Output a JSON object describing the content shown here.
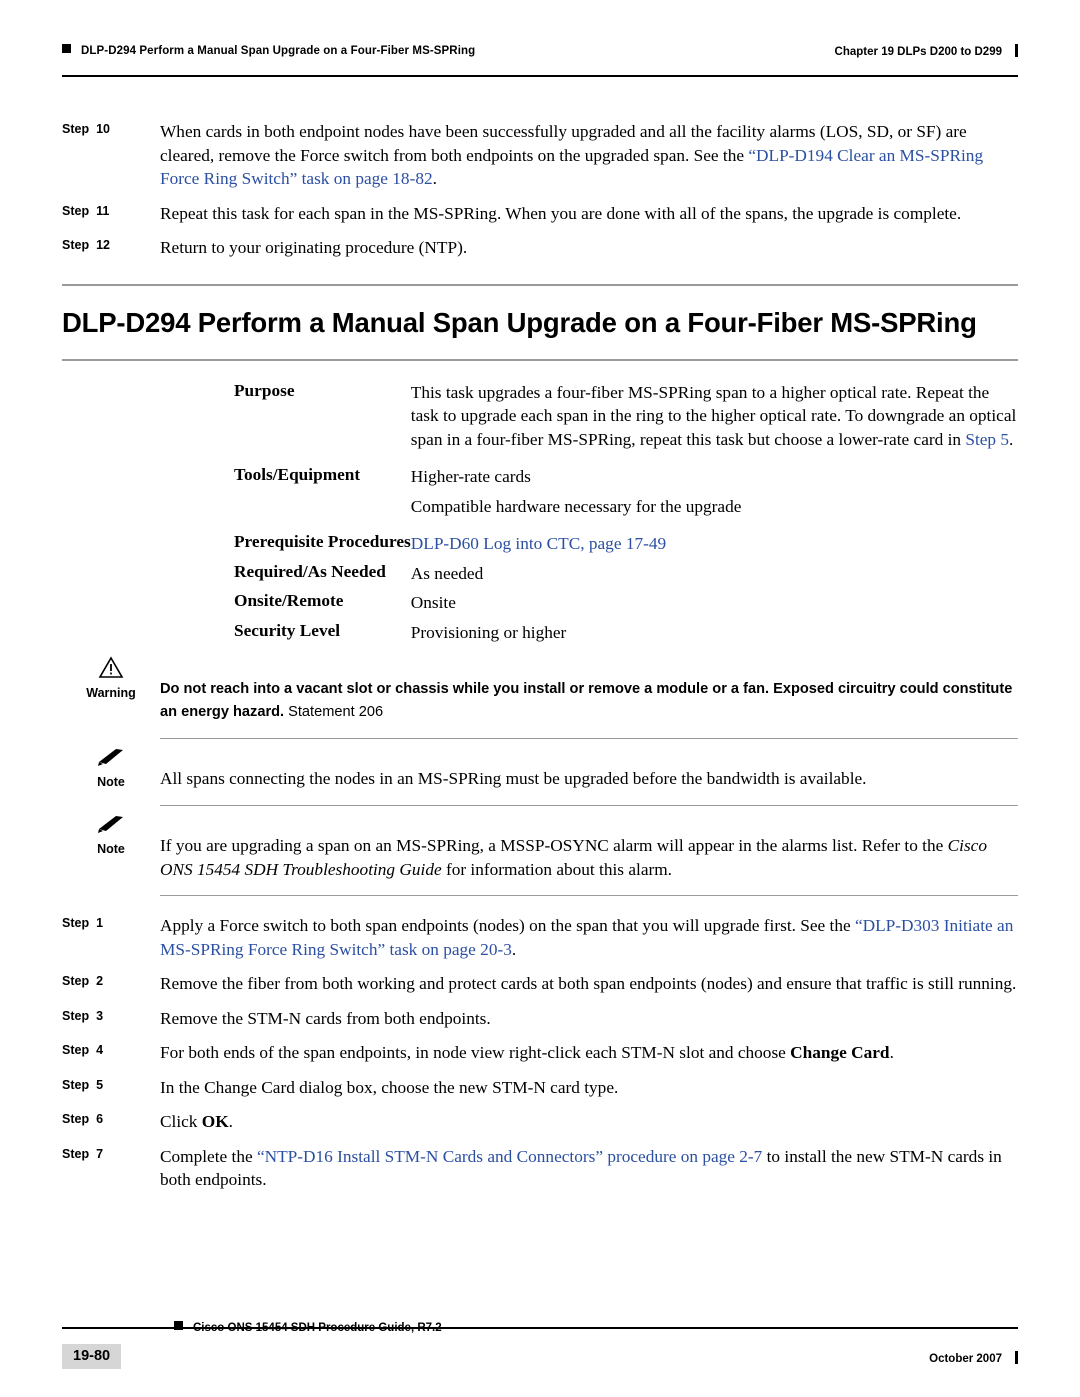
{
  "header": {
    "left": "DLP-D294 Perform a Manual Span Upgrade on a Four-Fiber MS-SPRing",
    "right": "Chapter 19 DLPs D200 to D299"
  },
  "top_steps": [
    {
      "label": "Step",
      "num": "10",
      "text_before": "When cards in both endpoint nodes have been successfully upgraded and all the facility alarms (LOS, SD, or SF) are cleared, remove the Force switch from both endpoints on the upgraded span. See the ",
      "link": "“DLP-D194 Clear an MS-SPRing Force Ring Switch” task on page 18-82",
      "text_after": "."
    },
    {
      "label": "Step",
      "num": "11",
      "text_before": "Repeat this task for each span in the MS-SPRing. When you are done with all of the spans, the upgrade is complete.",
      "link": "",
      "text_after": ""
    },
    {
      "label": "Step",
      "num": "12",
      "text_before": "Return to your originating procedure (NTP).",
      "link": "",
      "text_after": ""
    }
  ],
  "section": {
    "title": "DLP-D294 Perform a Manual Span Upgrade on a Four-Fiber MS-SPRing"
  },
  "definitions": [
    {
      "key": "Purpose",
      "value_pre": "This task upgrades a four-fiber MS-SPRing span to a higher optical rate. Repeat the task to upgrade each span in the ring to the higher optical rate. To downgrade an optical span in a four-fiber MS-SPRing, repeat this task but choose a lower-rate card in ",
      "value_link": "Step 5",
      "value_post": ".",
      "value2": ""
    },
    {
      "key": "Tools/Equipment",
      "value_pre": "Higher-rate cards",
      "value_link": "",
      "value_post": "",
      "value2": "Compatible hardware necessary for the upgrade"
    },
    {
      "key": "Prerequisite Procedures",
      "value_pre": "",
      "value_link": "DLP-D60 Log into CTC, page 17-49",
      "value_post": "",
      "value2": ""
    },
    {
      "key": "Required/As Needed",
      "value_pre": "As needed",
      "value_link": "",
      "value_post": "",
      "value2": ""
    },
    {
      "key": "Onsite/Remote",
      "value_pre": "Onsite",
      "value_link": "",
      "value_post": "",
      "value2": ""
    },
    {
      "key": "Security Level",
      "value_pre": "Provisioning or higher",
      "value_link": "",
      "value_post": "",
      "value2": ""
    }
  ],
  "warning": {
    "label": "Warning",
    "icon": "warning-triangle-icon",
    "bold_text": "Do not reach into a vacant slot or chassis while you install or remove a module or a fan. Exposed circuitry could constitute an energy hazard.",
    "statement": " Statement 206"
  },
  "note1": {
    "label": "Note",
    "icon": "note-pencil-icon",
    "text": "All spans connecting the nodes in an MS-SPRing must be upgraded before the bandwidth is available."
  },
  "note2": {
    "label": "Note",
    "icon": "note-pencil-icon",
    "text_pre": "If you are upgrading a span on an MS-SPRing, a MSSP-OSYNC alarm will appear in the alarms list. Refer to the ",
    "italic": "Cisco ONS 15454 SDH Troubleshooting Guide",
    "text_post": " for information about this alarm."
  },
  "bottom_steps": [
    {
      "label": "Step",
      "num": "1",
      "pre": "Apply a Force switch to both span endpoints (nodes) on the span that you will upgrade first. See the ",
      "link": "“DLP-D303 Initiate an MS-SPRing Force Ring Switch” task on page 20-3",
      "post": ".",
      "bold": ""
    },
    {
      "label": "Step",
      "num": "2",
      "pre": "Remove the fiber from both working and protect cards at both span endpoints (nodes) and ensure that traffic is still running.",
      "link": "",
      "post": "",
      "bold": ""
    },
    {
      "label": "Step",
      "num": "3",
      "pre": "Remove the STM-N cards from both endpoints.",
      "link": "",
      "post": "",
      "bold": ""
    },
    {
      "label": "Step",
      "num": "4",
      "pre": "For both ends of the span endpoints, in node view right-click each STM-N slot and choose ",
      "link": "",
      "post": ".",
      "bold": "Change Card"
    },
    {
      "label": "Step",
      "num": "5",
      "pre": "In the Change Card dialog box, choose the new STM-N card type.",
      "link": "",
      "post": "",
      "bold": ""
    },
    {
      "label": "Step",
      "num": "6",
      "pre": "Click ",
      "link": "",
      "post": ".",
      "bold": "OK"
    },
    {
      "label": "Step",
      "num": "7",
      "pre": "Complete the ",
      "link": "“NTP-D16 Install STM-N Cards and Connectors” procedure on page 2-7",
      "post": " to install the new STM-N cards in both endpoints.",
      "bold": ""
    }
  ],
  "footer": {
    "page": "19-80",
    "center": "Cisco ONS 15454 SDH Procedure Guide, R7.2",
    "right": "October 2007"
  }
}
